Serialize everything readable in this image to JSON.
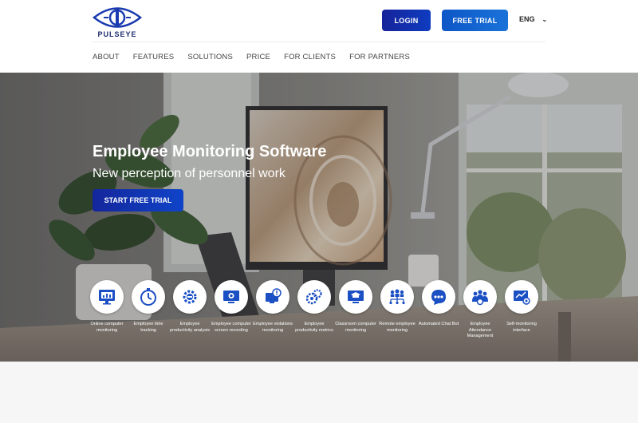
{
  "header": {
    "logo_text": "PULSEYE",
    "login_label": "LOGIN",
    "trial_label": "FREE TRIAL",
    "language": "ENG",
    "nav": [
      {
        "label": "ABOUT"
      },
      {
        "label": "FEATURES"
      },
      {
        "label": "SOLUTIONS"
      },
      {
        "label": "PRICE"
      },
      {
        "label": "FOR CLIENTS"
      },
      {
        "label": "FOR PARTNERS"
      }
    ]
  },
  "hero": {
    "title": "Employee Monitoring Software",
    "subtitle": "New perception of personnel work",
    "cta_label": "START FREE TRIAL",
    "features": [
      {
        "label": "Online computer monitoring",
        "icon": "monitor-chart-icon"
      },
      {
        "label": "Employee time tracking",
        "icon": "stopwatch-icon"
      },
      {
        "label": "Employee productivity analysis",
        "icon": "gear-analysis-icon"
      },
      {
        "label": "Employee computer screen recording",
        "icon": "screen-record-icon"
      },
      {
        "label": "Employee violations monitoring",
        "icon": "violation-alert-icon"
      },
      {
        "label": "Employee productivity metrics",
        "icon": "gears-metrics-icon"
      },
      {
        "label": "Classroom computer monitoring",
        "icon": "classroom-icon"
      },
      {
        "label": "Remote employee monitoring",
        "icon": "remote-team-icon"
      },
      {
        "label": "Automated Chat Bot",
        "icon": "chat-bot-icon"
      },
      {
        "label": "Employee Attendance Management",
        "icon": "attendance-team-icon"
      },
      {
        "label": "Self-monitoring interface",
        "icon": "self-monitor-icon"
      }
    ]
  },
  "colors": {
    "brand_dark": "#16239a",
    "brand_blue": "#1a73d9",
    "icon_blue": "#1b4fc4"
  }
}
